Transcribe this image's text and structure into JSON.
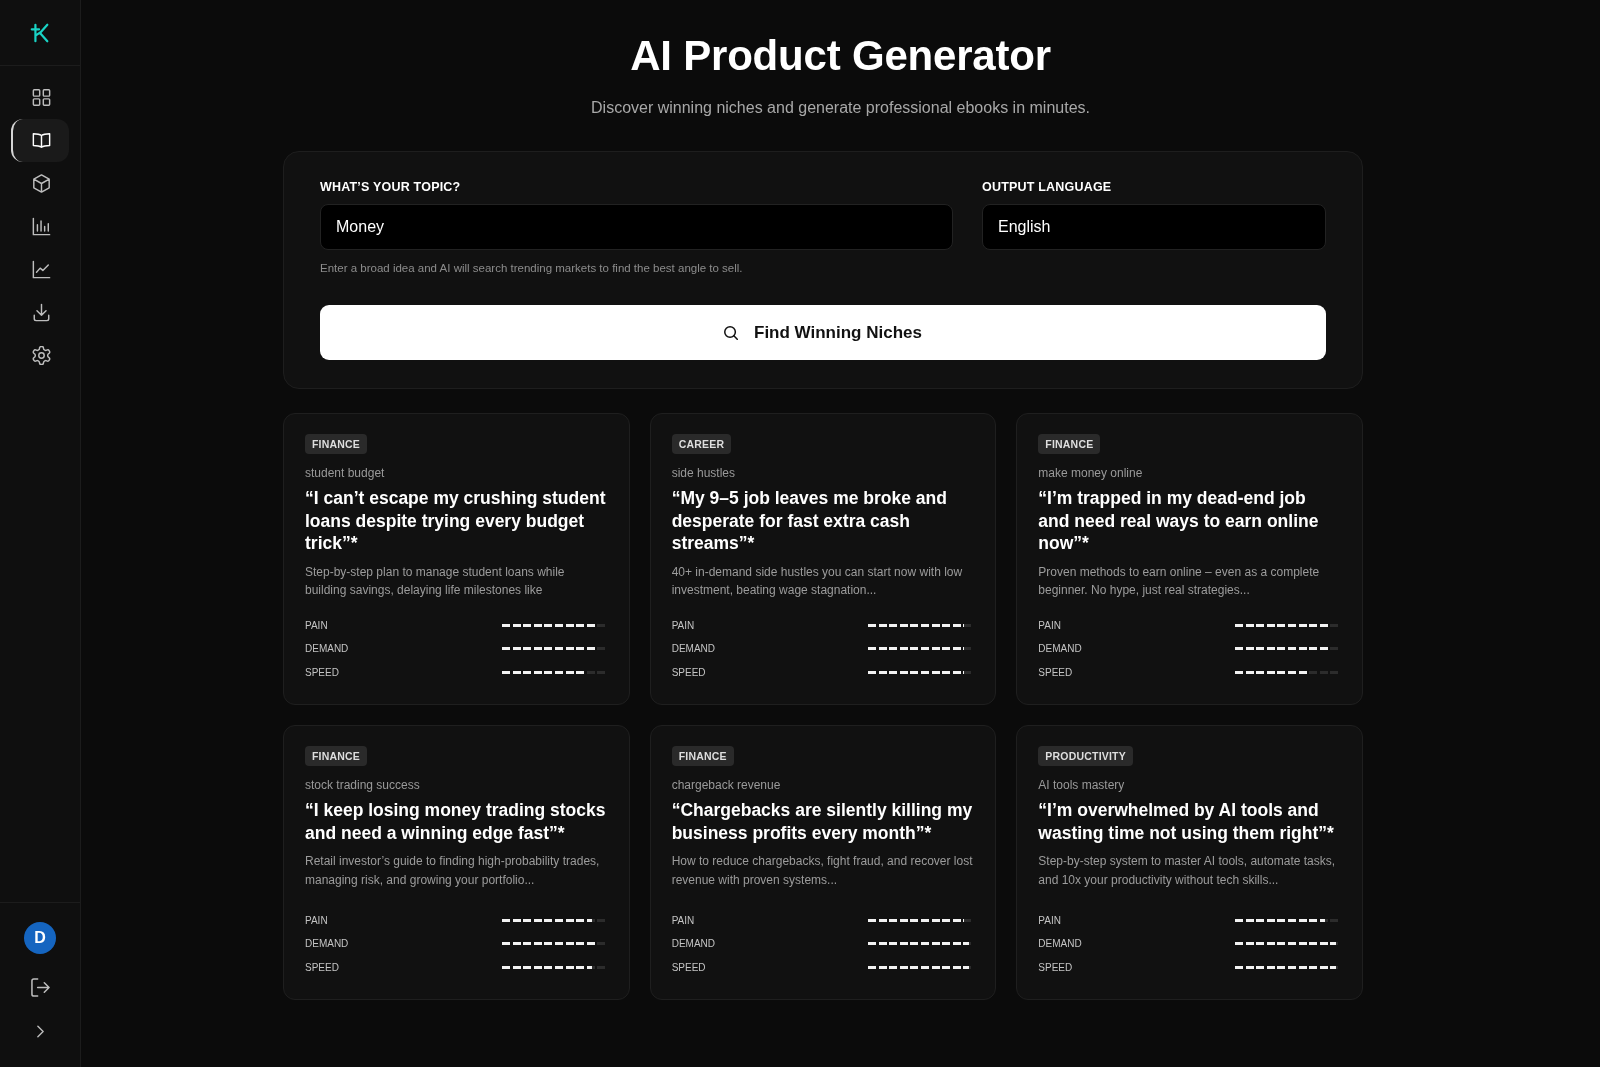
{
  "sidebar": {
    "items": [
      {
        "selected": false
      },
      {
        "selected": true
      },
      {
        "selected": false
      },
      {
        "selected": false
      },
      {
        "selected": false
      },
      {
        "selected": false
      },
      {
        "selected": false
      }
    ]
  },
  "user": {
    "initial": "D"
  },
  "header": {
    "title": "AI Product Generator",
    "subtitle": "Discover winning niches and generate professional ebooks in minutes."
  },
  "form": {
    "topic": {
      "label": "WHAT’S YOUR TOPIC?",
      "value": "Money",
      "hint": "Enter a broad idea and AI will search trending markets to find the best angle to sell."
    },
    "language": {
      "label": "OUTPUT LANGUAGE",
      "value": "English"
    },
    "button": "Find Winning Niches"
  },
  "niches": [
    {
      "category": "FINANCE",
      "niche": "student budget",
      "headline": "“I can’t escape my crushing student loans despite trying every budget trick”*",
      "description": "Step-by-step plan to manage student loans while building savings, delaying life milestones like",
      "metrics": [
        {
          "label": "PAIN",
          "level": 0.9
        },
        {
          "label": "DEMAND",
          "level": 0.9
        },
        {
          "label": "SPEED",
          "level": 0.8
        }
      ]
    },
    {
      "category": "CAREER",
      "niche": "side hustles",
      "headline": "“My 9–5 job leaves me broke and desperate for fast extra cash streams”*",
      "description": "40+ in-demand side hustles you can start now with low investment, beating wage stagnation...",
      "metrics": [
        {
          "label": "PAIN",
          "level": 0.9
        },
        {
          "label": "DEMAND",
          "level": 0.9
        },
        {
          "label": "SPEED",
          "level": 0.9
        }
      ]
    },
    {
      "category": "FINANCE",
      "niche": "make money online",
      "headline": "“I’m trapped in my dead-end job and need real ways to earn online now”*",
      "description": "Proven methods to earn online – even as a complete beginner. No hype, just real strategies...",
      "metrics": [
        {
          "label": "PAIN",
          "level": 0.9
        },
        {
          "label": "DEMAND",
          "level": 0.9
        },
        {
          "label": "SPEED",
          "level": 0.7
        }
      ]
    },
    {
      "category": "FINANCE",
      "niche": "stock trading success",
      "headline": "“I keep losing money trading stocks and need a winning edge fast”*",
      "description": "Retail investor’s guide to finding high-probability trades, managing risk, and growing your portfolio...",
      "metrics": [
        {
          "label": "PAIN",
          "level": 0.85
        },
        {
          "label": "DEMAND",
          "level": 0.9
        },
        {
          "label": "SPEED",
          "level": 0.85
        }
      ]
    },
    {
      "category": "FINANCE",
      "niche": "chargeback revenue",
      "headline": "“Chargebacks are silently killing my business profits every month”*",
      "description": "How to reduce chargebacks, fight fraud, and recover lost revenue with proven systems...",
      "metrics": [
        {
          "label": "PAIN",
          "level": 0.9
        },
        {
          "label": "DEMAND",
          "level": 0.95
        },
        {
          "label": "SPEED",
          "level": 0.95
        }
      ]
    },
    {
      "category": "PRODUCTIVITY",
      "niche": "AI tools mastery",
      "headline": "“I’m overwhelmed by AI tools and wasting time not using them right”*",
      "description": "Step-by-step system to master AI tools, automate tasks, and 10x your productivity without tech skills...",
      "metrics": [
        {
          "label": "PAIN",
          "level": 0.85
        },
        {
          "label": "DEMAND",
          "level": 0.95
        },
        {
          "label": "SPEED",
          "level": 0.95
        }
      ]
    }
  ]
}
